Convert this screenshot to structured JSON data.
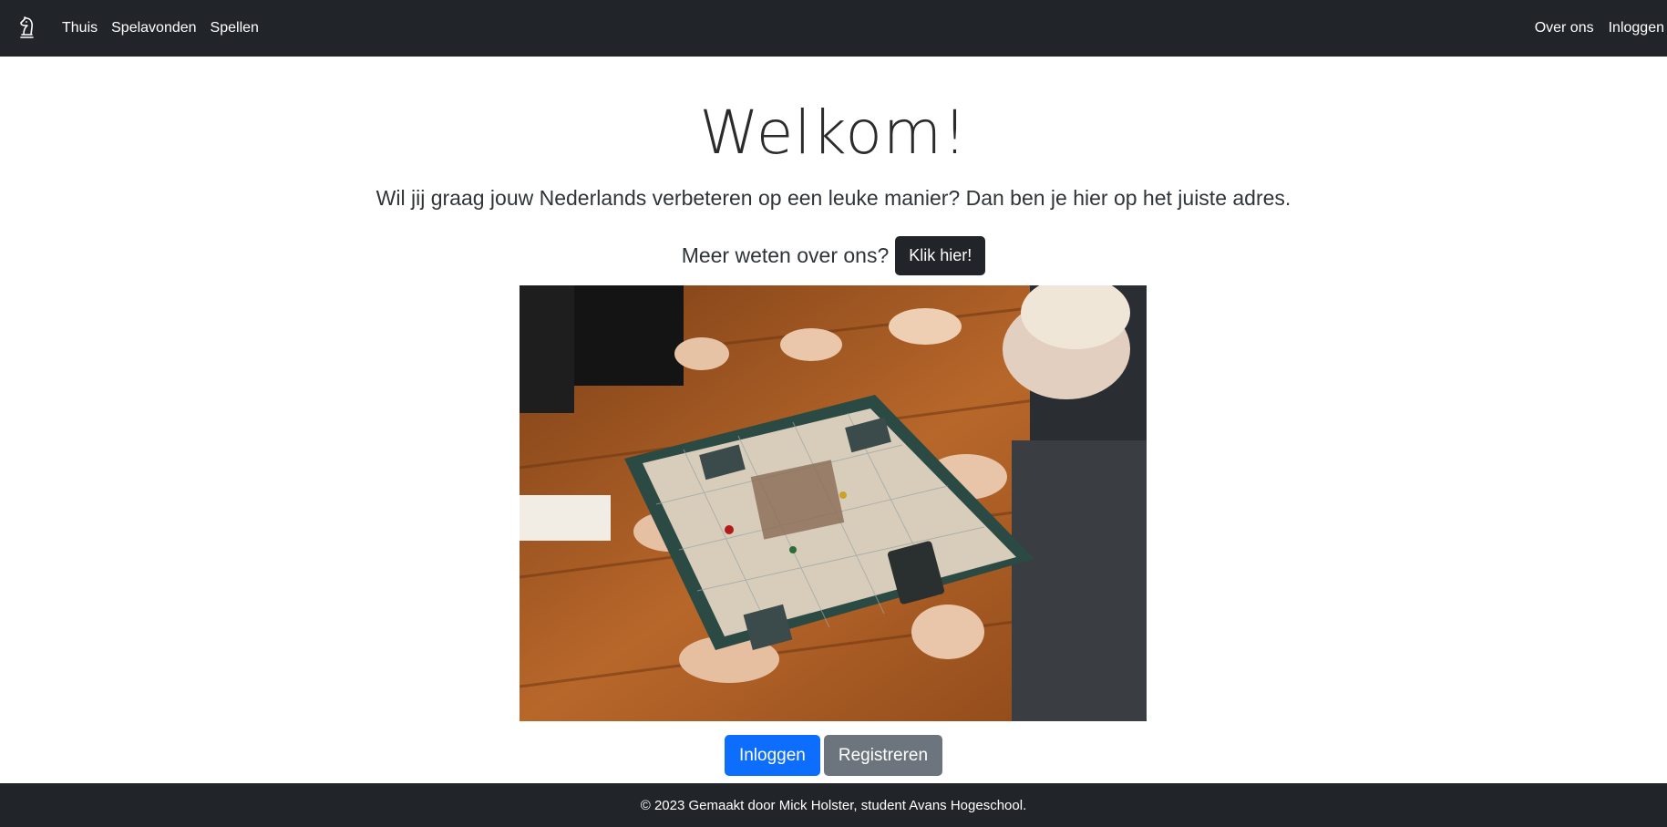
{
  "navbar": {
    "brand_icon": "chess-knight-icon",
    "left_items": [
      {
        "label": "Thuis"
      },
      {
        "label": "Spelavonden"
      },
      {
        "label": "Spellen"
      }
    ],
    "right_items": [
      {
        "label": "Over ons"
      },
      {
        "label": "Inloggen"
      }
    ]
  },
  "main": {
    "title": "Welkom!",
    "lead": "Wil jij graag jouw Nederlands verbeteren op een leuke manier? Dan ben je hier op het juiste adres.",
    "more_text": "Meer weten over ons?",
    "more_button": "Klik hier!",
    "login_button": "Inloggen",
    "register_button": "Registreren"
  },
  "footer": {
    "text": "© 2023 Gemaakt door Mick Holster, student Avans Hogeschool."
  },
  "colors": {
    "navbar": "#212529",
    "primary": "#0d6efd",
    "secondary": "#6c757d"
  }
}
